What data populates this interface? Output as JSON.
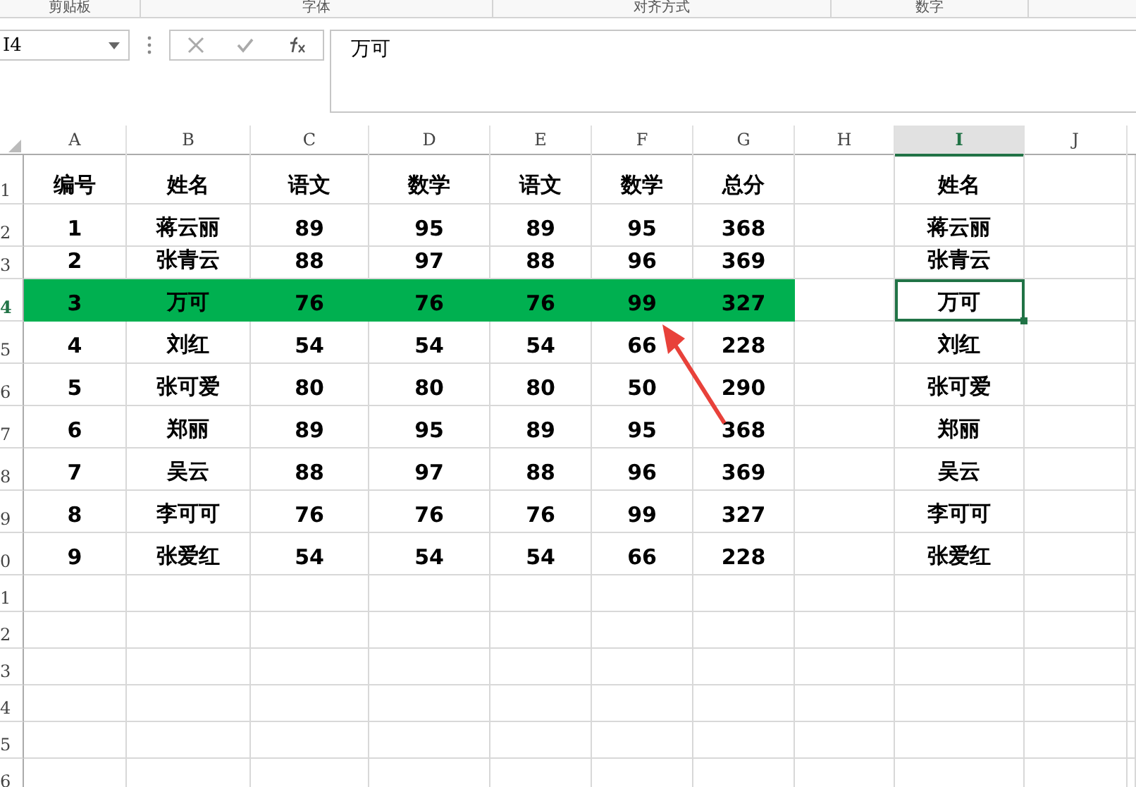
{
  "ribbon_groups": [
    {
      "label": "剪贴板"
    },
    {
      "label": "字体"
    },
    {
      "label": "对齐方式"
    },
    {
      "label": "数字"
    }
  ],
  "name_box": {
    "value": "I4"
  },
  "formula_bar": {
    "value": "万可"
  },
  "columns": [
    {
      "label": "A",
      "selected": false
    },
    {
      "label": "B",
      "selected": false
    },
    {
      "label": "C",
      "selected": false
    },
    {
      "label": "D",
      "selected": false
    },
    {
      "label": "E",
      "selected": false
    },
    {
      "label": "F",
      "selected": false
    },
    {
      "label": "G",
      "selected": false
    },
    {
      "label": "H",
      "selected": false
    },
    {
      "label": "I",
      "selected": true
    },
    {
      "label": "J",
      "selected": false
    }
  ],
  "rows": [
    {
      "number": "1",
      "selected": false,
      "highlighted": false,
      "cells": [
        "编号",
        "姓名",
        "语文",
        "数学",
        "语文",
        "数学",
        "总分"
      ],
      "column_i": {
        "text": "姓名",
        "selected": false
      }
    },
    {
      "number": "2",
      "selected": false,
      "highlighted": false,
      "cells": [
        "1",
        "蒋云丽",
        "89",
        "95",
        "89",
        "95",
        "368"
      ],
      "column_i": {
        "text": "蒋云丽",
        "selected": false
      }
    },
    {
      "number": "3",
      "selected": false,
      "highlighted": false,
      "cells": [
        "2",
        "张青云",
        "88",
        "97",
        "88",
        "96",
        "369"
      ],
      "column_i": {
        "text": "张青云",
        "selected": false
      }
    },
    {
      "number": "4",
      "selected": true,
      "highlighted": true,
      "cells": [
        "3",
        "万可",
        "76",
        "76",
        "76",
        "99",
        "327"
      ],
      "column_i": {
        "text": "万可",
        "selected": true
      }
    },
    {
      "number": "5",
      "selected": false,
      "highlighted": false,
      "cells": [
        "4",
        "刘红",
        "54",
        "54",
        "54",
        "66",
        "228"
      ],
      "column_i": {
        "text": "刘红",
        "selected": false
      }
    },
    {
      "number": "6",
      "selected": false,
      "highlighted": false,
      "cells": [
        "5",
        "张可爱",
        "80",
        "80",
        "80",
        "50",
        "290"
      ],
      "column_i": {
        "text": "张可爱",
        "selected": false
      }
    },
    {
      "number": "7",
      "selected": false,
      "highlighted": false,
      "cells": [
        "6",
        "郑丽",
        "89",
        "95",
        "89",
        "95",
        "368"
      ],
      "column_i": {
        "text": "郑丽",
        "selected": false
      }
    },
    {
      "number": "8",
      "selected": false,
      "highlighted": false,
      "cells": [
        "7",
        "吴云",
        "88",
        "97",
        "88",
        "96",
        "369"
      ],
      "column_i": {
        "text": "吴云",
        "selected": false
      }
    },
    {
      "number": "9",
      "selected": false,
      "highlighted": false,
      "cells": [
        "8",
        "李可可",
        "76",
        "76",
        "76",
        "99",
        "327"
      ],
      "column_i": {
        "text": "李可可",
        "selected": false
      }
    },
    {
      "number": "0",
      "selected": false,
      "highlighted": false,
      "cells": [
        "9",
        "张爱红",
        "54",
        "54",
        "54",
        "66",
        "228"
      ],
      "column_i": {
        "text": "张爱红",
        "selected": false
      }
    },
    {
      "number": "1",
      "selected": false,
      "highlighted": false
    },
    {
      "number": "2",
      "selected": false,
      "highlighted": false
    },
    {
      "number": "3",
      "selected": false,
      "highlighted": false
    },
    {
      "number": "4",
      "selected": false,
      "highlighted": false
    },
    {
      "number": "5",
      "selected": false,
      "highlighted": false
    },
    {
      "number": "6",
      "selected": false,
      "highlighted": false
    }
  ]
}
